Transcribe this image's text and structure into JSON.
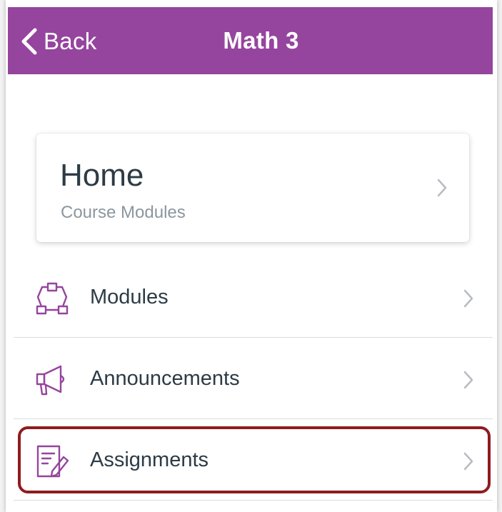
{
  "nav": {
    "back_label": "Back",
    "title": "Math 3",
    "color": "#95459e"
  },
  "home_card": {
    "title": "Home",
    "subtitle": "Course Modules"
  },
  "menu": [
    {
      "label": "Modules",
      "icon": "modules-icon"
    },
    {
      "label": "Announcements",
      "icon": "megaphone-icon"
    },
    {
      "label": "Assignments",
      "icon": "assignment-icon",
      "highlighted": true
    }
  ],
  "colors": {
    "accent": "#95459e",
    "text": "#2d3b45",
    "subtext": "#8b969e",
    "highlight_border": "#8e1c1f"
  }
}
